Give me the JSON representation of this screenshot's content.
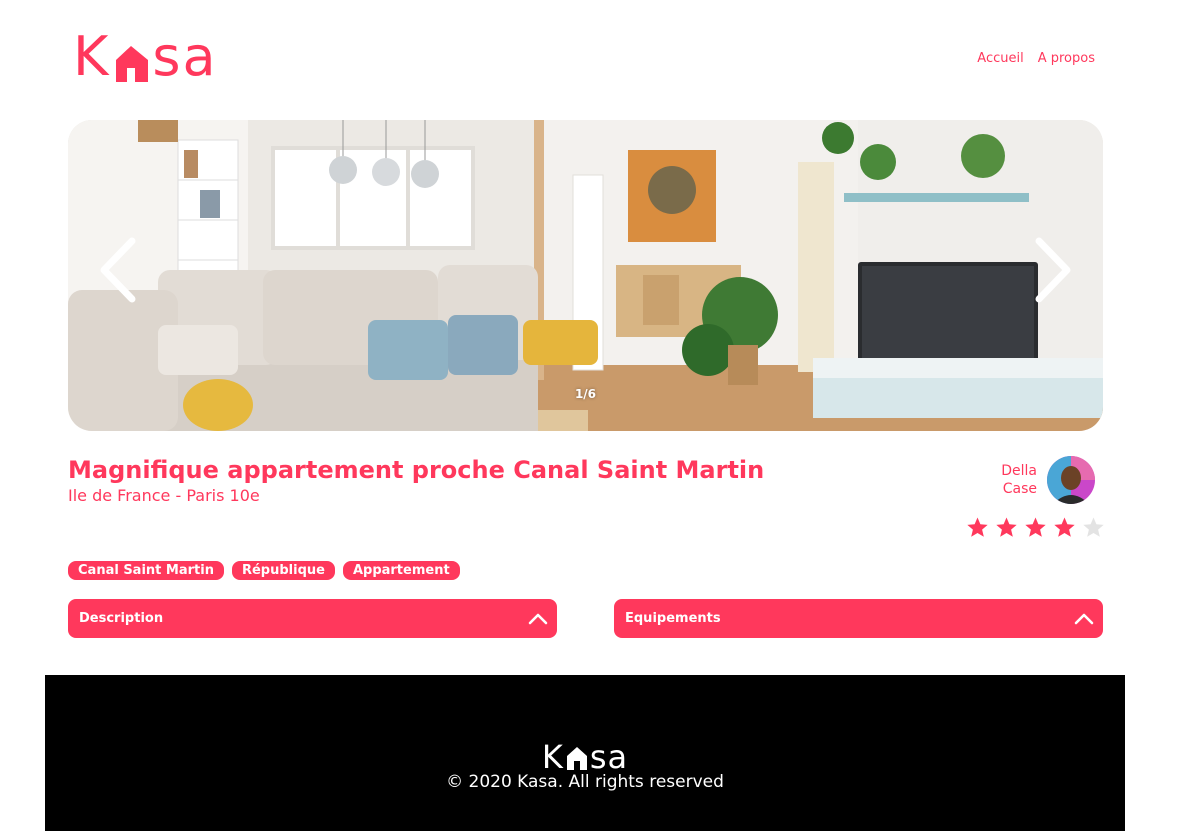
{
  "header": {
    "logo": {
      "before": "K",
      "after": "sa"
    },
    "nav": [
      {
        "label": "Accueil"
      },
      {
        "label": "A propos"
      }
    ]
  },
  "carousel": {
    "counter": "1/6",
    "icons": {
      "prev": "chevron-left-icon",
      "next": "chevron-right-icon"
    }
  },
  "listing": {
    "title": "Magnifique appartement proche Canal Saint Martin",
    "location": "Ile de France - Paris 10e",
    "host": {
      "first_name": "Della",
      "last_name": "Case"
    },
    "rating": {
      "value": 4,
      "max": 5
    },
    "tags": [
      "Canal Saint Martin",
      "République",
      "Appartement"
    ]
  },
  "collapses": [
    {
      "title": "Description",
      "icon": "chevron-up-icon"
    },
    {
      "title": "Equipements",
      "icon": "chevron-up-icon"
    }
  ],
  "footer": {
    "logo": {
      "before": "K",
      "after": "sa"
    },
    "copyright": "© 2020 Kasa. All rights reserved"
  },
  "colors": {
    "accent": "#FF385C",
    "star_empty": "#E3E3E3",
    "footer_bg": "#000000"
  }
}
